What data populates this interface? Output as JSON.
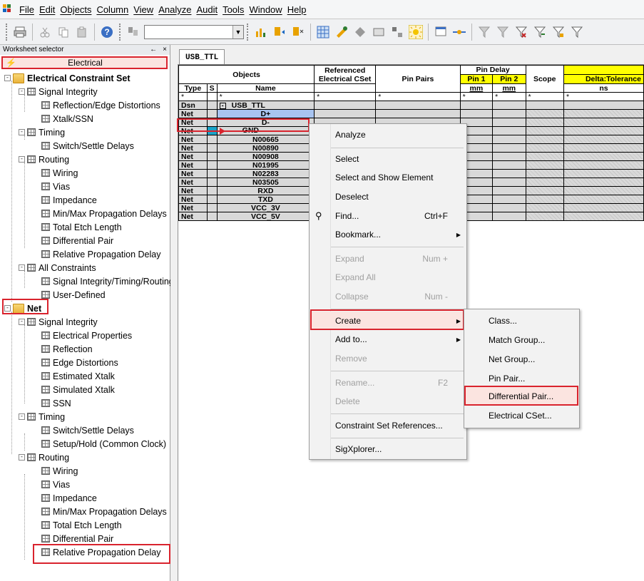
{
  "menubar": {
    "items": [
      "File",
      "Edit",
      "Objects",
      "Column",
      "View",
      "Analyze",
      "Audit",
      "Tools",
      "Window",
      "Help"
    ]
  },
  "toolbar": {
    "combo_value": ""
  },
  "worksheet_selector": {
    "title": "Worksheet selector",
    "pin": "←",
    "close": "×",
    "active": "Electrical"
  },
  "tree": {
    "ecs": "Electrical Constraint Set",
    "si": "Signal Integrity",
    "refl_edge": "Reflection/Edge Distortions",
    "xtalk_ssn": "Xtalk/SSN",
    "timing": "Timing",
    "switch_settle": "Switch/Settle Delays",
    "routing": "Routing",
    "wiring": "Wiring",
    "vias": "Vias",
    "impedance": "Impedance",
    "minmax": "Min/Max Propagation Delays",
    "total_etch": "Total Etch Length",
    "diff_pair": "Differential Pair",
    "rel_prop": "Relative Propagation Delay",
    "all_constraints": "All Constraints",
    "si_timing_rout": "Signal Integrity/Timing/Routing",
    "user_defined": "User-Defined",
    "net": "Net",
    "net_si": "Signal Integrity",
    "elec_props": "Electrical Properties",
    "reflection": "Reflection",
    "edge_dist": "Edge Distortions",
    "est_xtalk": "Estimated Xtalk",
    "sim_xtalk": "Simulated Xtalk",
    "ssn": "SSN",
    "net_timing": "Timing",
    "net_switch": "Switch/Settle Delays",
    "setup_hold": "Setup/Hold (Common Clock)",
    "net_routing": "Routing",
    "net_wiring": "Wiring",
    "net_vias": "Vias",
    "net_impedance": "Impedance",
    "net_minmax": "Min/Max Propagation Delays",
    "net_total_etch": "Total Etch Length",
    "net_diff_pair": "Differential Pair",
    "net_rel_prop": "Relative Propagation Delay"
  },
  "tab": "USB_TTL",
  "grid": {
    "col_objects": "Objects",
    "col_type": "Type",
    "col_s": "S",
    "col_name": "Name",
    "col_ref_cset": "Referenced Electrical CSet",
    "col_pin_pairs": "Pin Pairs",
    "col_pin_delay": "Pin Delay",
    "col_pin1": "Pin 1",
    "col_pin2": "Pin 2",
    "unit_mm": "mm",
    "col_scope": "Scope",
    "col_delta": "Delta:Tolerance",
    "unit_ns": "ns",
    "star": "*",
    "design_type": "Dsn",
    "design_name": "USB_TTL",
    "rows": [
      {
        "type": "Net",
        "name": "D+"
      },
      {
        "type": "Net",
        "name": "D-"
      },
      {
        "type": "Net",
        "name": "GND"
      },
      {
        "type": "Net",
        "name": "N00665"
      },
      {
        "type": "Net",
        "name": "N00890"
      },
      {
        "type": "Net",
        "name": "N00908"
      },
      {
        "type": "Net",
        "name": "N01995"
      },
      {
        "type": "Net",
        "name": "N02283"
      },
      {
        "type": "Net",
        "name": "N03505"
      },
      {
        "type": "Net",
        "name": "RXD"
      },
      {
        "type": "Net",
        "name": "TXD"
      },
      {
        "type": "Net",
        "name": "VCC_3V"
      },
      {
        "type": "Net",
        "name": "VCC_5V"
      }
    ]
  },
  "context_menu": {
    "analyze": "Analyze",
    "select": "Select",
    "select_show": "Select and Show Element",
    "deselect": "Deselect",
    "find": "Find...",
    "find_sc": "Ctrl+F",
    "bookmark": "Bookmark...",
    "expand": "Expand",
    "expand_sc": "Num +",
    "expand_all": "Expand All",
    "collapse": "Collapse",
    "collapse_sc": "Num -",
    "create": "Create",
    "add_to": "Add to...",
    "remove": "Remove",
    "rename": "Rename...",
    "rename_sc": "F2",
    "delete": "Delete",
    "cset_refs": "Constraint Set References...",
    "sigxplorer": "SigXplorer..."
  },
  "submenu": {
    "class": "Class...",
    "match_group": "Match Group...",
    "net_group": "Net Group...",
    "pin_pair": "Pin Pair...",
    "diff_pair": "Differential Pair...",
    "elec_cset": "Electrical CSet..."
  }
}
